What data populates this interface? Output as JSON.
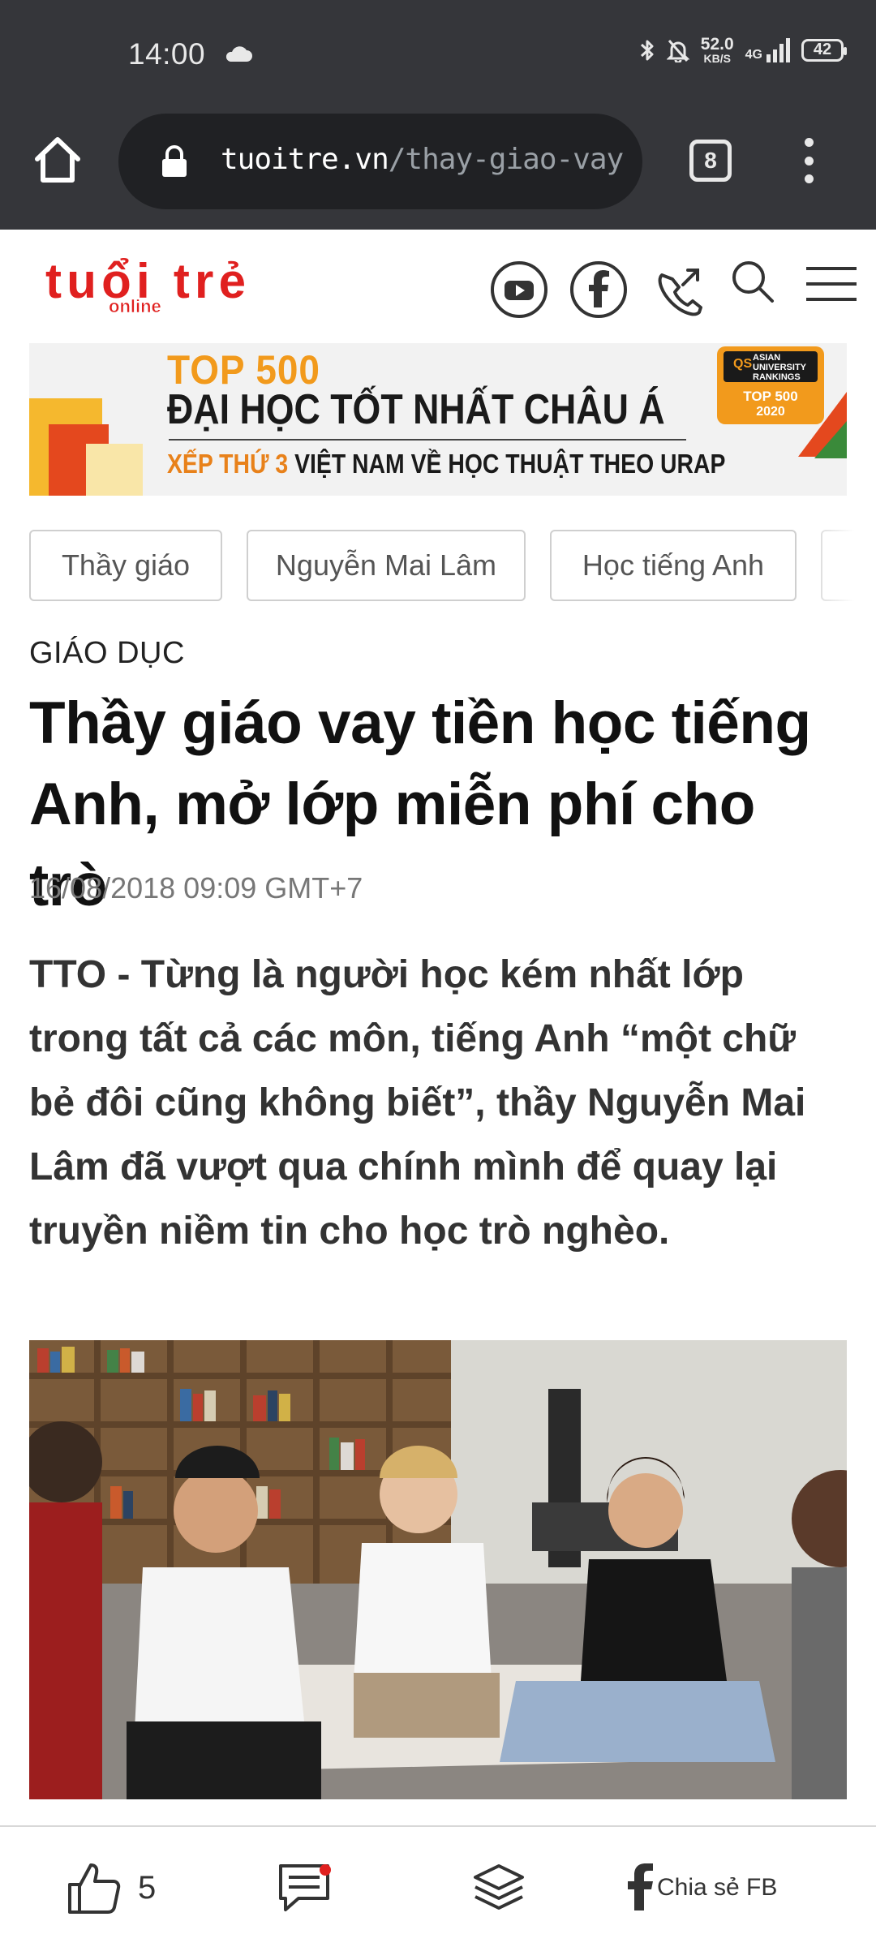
{
  "status_bar": {
    "time": "14:00",
    "net_speed_value": "52.0",
    "net_speed_unit": "KB/S",
    "network": "4G",
    "battery": "42"
  },
  "browser": {
    "url_host": "tuoitre.vn",
    "url_path": "/thay-giao-vay",
    "tab_count": "8"
  },
  "site": {
    "logo_main": "tuổi trẻ",
    "logo_sub": "online"
  },
  "banner": {
    "line1": "TOP 500",
    "line2": "ĐẠI HỌC TỐT NHẤT CHÂU Á",
    "line3_highlight": "XẾP THỨ 3",
    "line3_rest": "VIỆT NAM VỀ HỌC THUẬT THEO URAP",
    "badge_logo": "QS",
    "badge_title": "ASIAN UNIVERSITY RANKINGS",
    "badge_rank": "TOP 500",
    "badge_year": "2020"
  },
  "tags": [
    "Thầy giáo",
    "Nguyễn Mai Lâm",
    "Học tiếng Anh"
  ],
  "article": {
    "category": "GIÁO DỤC",
    "title": "Thầy giáo vay tiền học tiếng Anh, mở lớp miễn phí cho trò",
    "date": "16/08/2018 09:09 GMT+7",
    "lead": "TTO - Từng là người học kém nhất lớp trong tất cả các môn, tiếng Anh “một chữ bẻ đôi cũng không biết”, thầy Nguyễn Mai Lâm đã vượt qua chính mình để quay lại truyền niềm tin cho học trò nghèo."
  },
  "bottom_bar": {
    "like_count": "5",
    "share_label": "Chia sẻ FB"
  },
  "colors": {
    "brand_red": "#e0201f",
    "chrome_bg": "#35363a",
    "banner_orange": "#f29a1c"
  }
}
